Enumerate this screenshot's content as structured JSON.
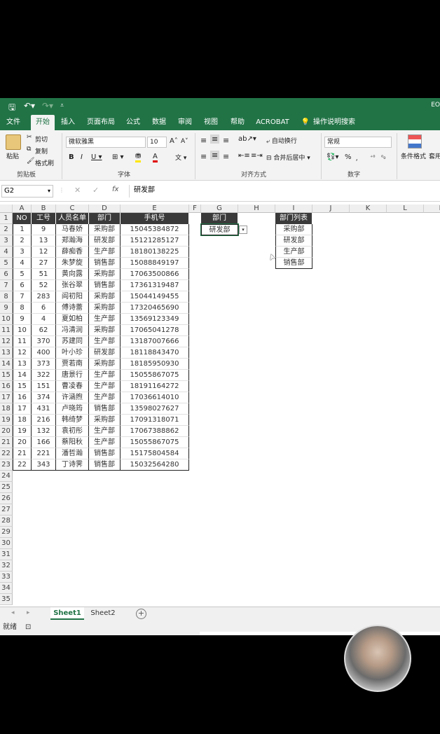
{
  "title_right": "EO",
  "tabs": [
    "文件",
    "开始",
    "插入",
    "页面布局",
    "公式",
    "数据",
    "审阅",
    "视图",
    "帮助",
    "ACROBAT",
    "操作说明搜索"
  ],
  "ribbon": {
    "paste": "粘贴",
    "cut": "剪切",
    "copy": "复制",
    "format_painter": "格式刷",
    "clipboard_group": "剪贴板",
    "font_name": "微软雅黑",
    "font_size": "10",
    "font_group": "字体",
    "wrap_text": "自动换行",
    "merge_center": "合并后居中",
    "align_group": "对齐方式",
    "number_format": "常规",
    "number_group": "数字",
    "conditional": "条件格式",
    "table_fmt": "套用表格"
  },
  "formula_bar": {
    "name_box": "G2",
    "fx": "fx",
    "value": "研发部"
  },
  "columns": [
    "A",
    "B",
    "C",
    "D",
    "E",
    "F",
    "G",
    "H",
    "I",
    "J",
    "K",
    "L",
    "M"
  ],
  "rows": [
    "1",
    "2",
    "3",
    "4",
    "5",
    "6",
    "7",
    "8",
    "9",
    "10",
    "11",
    "12",
    "13",
    "14",
    "15",
    "16",
    "17",
    "18",
    "19",
    "20",
    "21",
    "22",
    "23",
    "24",
    "25",
    "26",
    "27",
    "28",
    "29",
    "30",
    "31",
    "32",
    "33",
    "34",
    "35"
  ],
  "table": {
    "headers": [
      "NO",
      "工号",
      "人员名单",
      "部门",
      "手机号"
    ],
    "rows": [
      [
        "1",
        "9",
        "马春娇",
        "采购部",
        "15045384872"
      ],
      [
        "2",
        "13",
        "郑瀚海",
        "研发部",
        "15121285127"
      ],
      [
        "3",
        "12",
        "薛痴香",
        "生产部",
        "18180138225"
      ],
      [
        "4",
        "27",
        "朱梦旋",
        "销售部",
        "15088849197"
      ],
      [
        "5",
        "51",
        "黄向露",
        "采购部",
        "17063500866"
      ],
      [
        "6",
        "52",
        "张谷翠",
        "销售部",
        "17361319487"
      ],
      [
        "7",
        "283",
        "阎初阳",
        "采购部",
        "15044149455"
      ],
      [
        "8",
        "6",
        "傅诗蕾",
        "采购部",
        "17320465690"
      ],
      [
        "9",
        "4",
        "夏如柏",
        "生产部",
        "13569123349"
      ],
      [
        "10",
        "62",
        "冯清润",
        "采购部",
        "17065041278"
      ],
      [
        "11",
        "370",
        "苏建同",
        "生产部",
        "13187007666"
      ],
      [
        "12",
        "400",
        "叶小珍",
        "研发部",
        "18118843470"
      ],
      [
        "13",
        "373",
        "贾若南",
        "采购部",
        "18185950930"
      ],
      [
        "14",
        "322",
        "唐景行",
        "生产部",
        "15055867075"
      ],
      [
        "15",
        "151",
        "曹凌春",
        "生产部",
        "18191164272"
      ],
      [
        "16",
        "374",
        "许涵煦",
        "生产部",
        "17036614010"
      ],
      [
        "17",
        "431",
        "卢晓筠",
        "销售部",
        "13598027627"
      ],
      [
        "18",
        "216",
        "韩绮梦",
        "采购部",
        "17091318071"
      ],
      [
        "19",
        "132",
        "袁初彤",
        "生产部",
        "17067388862"
      ],
      [
        "20",
        "166",
        "蔡阳秋",
        "生产部",
        "15055867075"
      ],
      [
        "21",
        "221",
        "潘哲瀚",
        "销售部",
        "15175804584"
      ],
      [
        "22",
        "343",
        "丁诗霁",
        "销售部",
        "15032564280"
      ]
    ]
  },
  "dept_filter": {
    "header": "部门",
    "value": "研发部"
  },
  "dept_list": {
    "header": "部门列表",
    "items": [
      "采购部",
      "研发部",
      "生产部",
      "销售部"
    ]
  },
  "sheets": [
    "Sheet1",
    "Sheet2"
  ],
  "status": "就绪"
}
